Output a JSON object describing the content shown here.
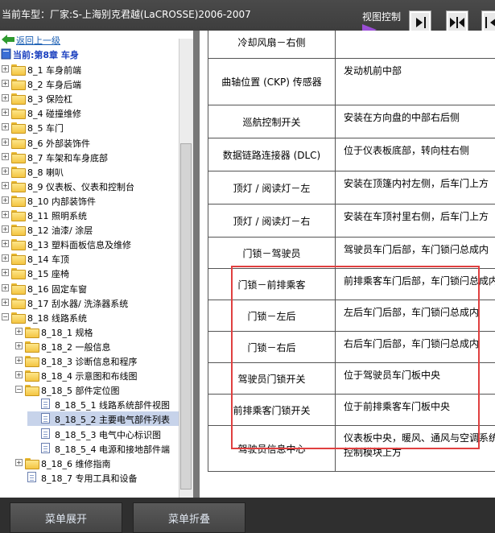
{
  "topbar": {
    "vehicle": "当前车型：厂家:S-上海别克君越(LaCROSSE)2006-2007",
    "view_control": "视图控制",
    "accent": "#9b4fd6"
  },
  "tree": {
    "back": "返回上一级",
    "current": "当前:第8章 车身",
    "items": [
      {
        "label": "8_1 车身前端",
        "kind": "folder"
      },
      {
        "label": "8_2 车身后端",
        "kind": "folder"
      },
      {
        "label": "8_3 保险杠",
        "kind": "folder"
      },
      {
        "label": "8_4 碰撞维修",
        "kind": "folder"
      },
      {
        "label": "8_5 车门",
        "kind": "folder"
      },
      {
        "label": "8_6 外部装饰件",
        "kind": "folder"
      },
      {
        "label": "8_7 车架和车身底部",
        "kind": "folder"
      },
      {
        "label": "8_8 喇叭",
        "kind": "folder"
      },
      {
        "label": "8_9 仪表板、仪表和控制台",
        "kind": "folder"
      },
      {
        "label": "8_10 内部装饰件",
        "kind": "folder"
      },
      {
        "label": "8_11 照明系统",
        "kind": "folder"
      },
      {
        "label": "8_12 油漆/ 涂层",
        "kind": "folder"
      },
      {
        "label": "8_13 塑料面板信息及维修",
        "kind": "folder"
      },
      {
        "label": "8_14 车顶",
        "kind": "folder"
      },
      {
        "label": "8_15 座椅",
        "kind": "folder"
      },
      {
        "label": "8_16 固定车窗",
        "kind": "folder"
      },
      {
        "label": "8_17 刮水器/ 洗涤器系统",
        "kind": "folder"
      },
      {
        "label": "8_18 线路系统",
        "kind": "folder-open"
      },
      {
        "label": "8_18_1 规格",
        "kind": "folder"
      },
      {
        "label": "8_18_2 一般信息",
        "kind": "folder"
      },
      {
        "label": "8_18_3 诊断信息和程序",
        "kind": "folder"
      },
      {
        "label": "8_18_4 示意图和布线图",
        "kind": "folder"
      },
      {
        "label": "8_18_5 部件定位图",
        "kind": "folder-open"
      },
      {
        "label": "8_18_5_1 线路系统部件视图",
        "kind": "doc"
      },
      {
        "label": "8_18_5_2 主要电气部件列表",
        "kind": "doc",
        "selected": true
      },
      {
        "label": "8_18_5_3 电气中心标识图",
        "kind": "doc"
      },
      {
        "label": "8_18_5_4 电源和接地部件端",
        "kind": "doc"
      },
      {
        "label": "8_18_6 维修指南",
        "kind": "folder"
      },
      {
        "label": "8_18_7 专用工具和设备",
        "kind": "doc"
      }
    ]
  },
  "table": {
    "rows": [
      {
        "name": "冷却风扇－右侧",
        "loc": ""
      },
      {
        "name": "曲轴位置 (CKP) 传感器",
        "loc": "发动机前中部"
      },
      {
        "name": "巡航控制开关",
        "loc": "安装在方向盘的中部右后侧"
      },
      {
        "name": "数据链路连接器 (DLC)",
        "loc": "位于仪表板底部，转向柱右侧"
      },
      {
        "name": "顶灯 / 阅读灯－左",
        "loc": "安装在顶篷内衬左侧，后车门上方"
      },
      {
        "name": "顶灯 / 阅读灯－右",
        "loc": "安装在车顶衬里右侧，后车门上方"
      },
      {
        "name": "门锁－驾驶员",
        "loc": "驾驶员车门后部，车门锁闩总成内"
      },
      {
        "name": "门锁－前排乘客",
        "loc": "前排乘客车门后部，车门锁闩总成内"
      },
      {
        "name": "门锁－左后",
        "loc": "左后车门后部，车门锁闩总成内"
      },
      {
        "name": "门锁－右后",
        "loc": "右后车门后部，车门锁闩总成内"
      },
      {
        "name": "驾驶员门锁开关",
        "loc": "位于驾驶员车门板中央"
      },
      {
        "name": "前排乘客门锁开关",
        "loc": "位于前排乘客车门板中央"
      },
      {
        "name": "驾驶员信息中心",
        "loc": "仪表板中央，暖风、通风与空调系统控制模块上方"
      }
    ]
  },
  "buttons": {
    "expand": "菜单展开",
    "collapse": "菜单折叠"
  }
}
